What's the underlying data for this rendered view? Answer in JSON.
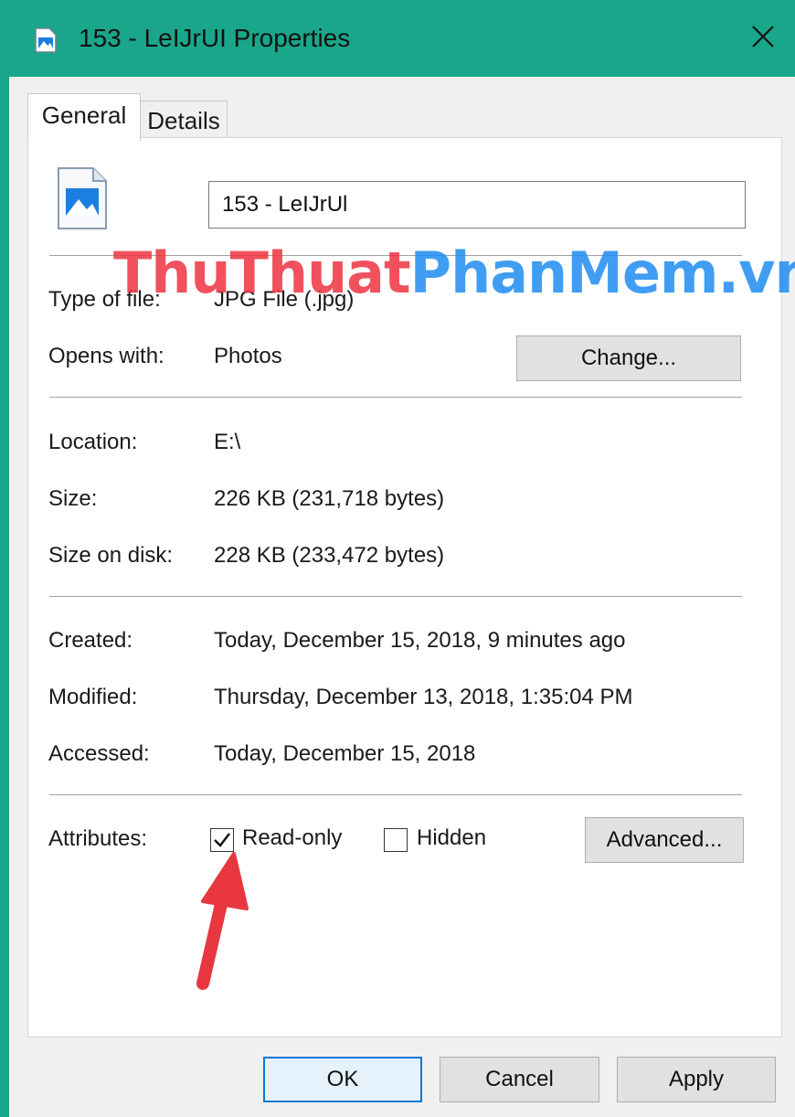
{
  "window": {
    "title": "153 - LeIJrUI Properties",
    "accent_color": "#1aa68a"
  },
  "tabs": [
    {
      "label": "General",
      "active": true
    },
    {
      "label": "Details",
      "active": false
    }
  ],
  "general": {
    "file_name": "153 - LeIJrUl",
    "type_label": "Type of file:",
    "type_value": "JPG File (.jpg)",
    "opens_label": "Opens with:",
    "opens_value": "Photos",
    "change_button": "Change...",
    "location_label": "Location:",
    "location_value": "E:\\",
    "size_label": "Size:",
    "size_value": "226 KB (231,718 bytes)",
    "size_disk_label": "Size on disk:",
    "size_disk_value": "228 KB (233,472 bytes)",
    "created_label": "Created:",
    "created_value": "Today, December 15, 2018, 9 minutes ago",
    "modified_label": "Modified:",
    "modified_value": "Thursday, December 13, 2018, 1:35:04 PM",
    "accessed_label": "Accessed:",
    "accessed_value": "Today, December 15, 2018",
    "attributes_label": "Attributes:",
    "readonly_label": "Read-only",
    "readonly_checked": true,
    "hidden_label": "Hidden",
    "hidden_checked": false,
    "advanced_button": "Advanced..."
  },
  "footer": {
    "ok": "OK",
    "cancel": "Cancel",
    "apply": "Apply"
  },
  "watermark": {
    "part1": "ThuThuat",
    "part2": "PhanMem.vn"
  },
  "icons": {
    "title": "image-file-icon",
    "file": "image-file-icon",
    "close": "close-icon",
    "annotation": "red-arrow-icon"
  }
}
